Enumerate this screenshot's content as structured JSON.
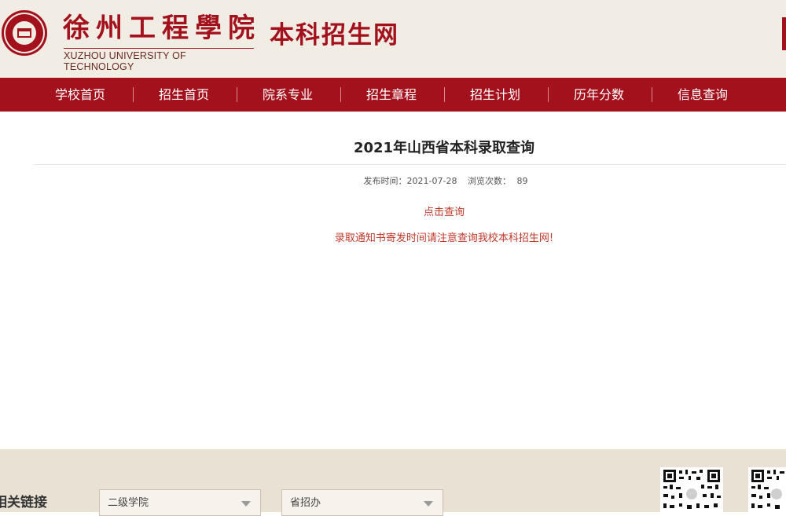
{
  "header": {
    "school_name_cn": "徐州工程學院",
    "school_name_en": "XUZHOU UNIVERSITY OF TECHNOLOGY",
    "site_name": "本科招生网"
  },
  "nav": {
    "items": [
      "学校首页",
      "招生首页",
      "院系专业",
      "招生章程",
      "招生计划",
      "历年分数",
      "信息查询"
    ]
  },
  "article": {
    "title": "2021年山西省本科录取查询",
    "publish_label": "发布时间：2021-07-28",
    "views_label": "浏览次数：",
    "views_count": "89",
    "query_link": "点击查询",
    "notice": "录取通知书寄发时间请注意查询我校本科招生网!"
  },
  "footer": {
    "title": "相关链接",
    "select1_value": "二级学院",
    "select2_value": "省招办"
  },
  "colors": {
    "brand_red": "#a3111d",
    "link_red": "#c0392b",
    "header_bg": "#f1ece4",
    "footer_bg": "#e8e1d4"
  }
}
